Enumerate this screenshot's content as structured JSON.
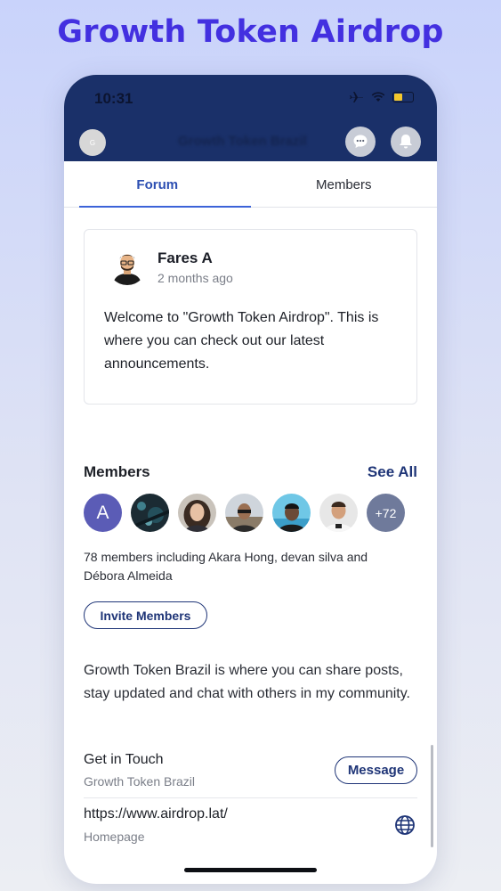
{
  "promo": {
    "title": "Growth Token Airdrop"
  },
  "status_bar": {
    "time": "10:31",
    "icons": [
      "airplane-icon",
      "wifi-icon",
      "battery-icon"
    ],
    "battery_color": "#f4c72c"
  },
  "header": {
    "avatar_initial": "G",
    "title": "Growth Token Brazil",
    "actions": [
      "chat-icon",
      "bell-icon"
    ],
    "background": "#1a3069"
  },
  "tabs": [
    {
      "label": "Forum",
      "active": true
    },
    {
      "label": "Members",
      "active": false
    }
  ],
  "post": {
    "author": "Fares A",
    "time": "2 months ago",
    "body": "Welcome to \"Growth Token Airdrop\". This is where you can check out our latest announcements."
  },
  "members": {
    "heading": "Members",
    "see_all": "See All",
    "first_initial": "A",
    "more_count": "+72",
    "summary": "78 members including Akara Hong, devan silva and Débora Almeida",
    "invite_label": "Invite Members"
  },
  "about": {
    "text": "Growth Token Brazil is where you can share posts, stay updated and chat with others in my community."
  },
  "contact": {
    "title": "Get in Touch",
    "subtitle": "Growth Token Brazil",
    "message_label": "Message"
  },
  "website": {
    "url": "https://www.airdrop.lat/",
    "label": "Homepage"
  },
  "colors": {
    "accent": "#1f3577",
    "promo": "#4330e0",
    "tab_active": "#3c63d8"
  }
}
